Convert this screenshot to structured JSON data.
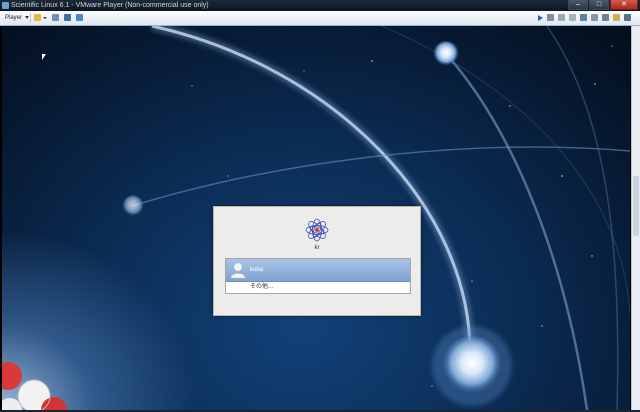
{
  "window": {
    "title": "Scientific Linux 6.1 - VMware Player (Non-commercial use only)",
    "buttons": {
      "minimize": "–",
      "maximize": "□",
      "close": "✕"
    }
  },
  "toolbar": {
    "player_menu": "Player",
    "left_icons": [
      "folder-icon",
      "vm-settings-icon",
      "fullscreen-icon",
      "unity-icon"
    ],
    "right_icons": [
      "play-icon",
      "network-adapter-icon",
      "usb-icon",
      "hard-disk-icon",
      "cd-drive-icon",
      "printer-icon",
      "sound-icon",
      "message-icon",
      "display-icon"
    ]
  },
  "login": {
    "hostname": "kr",
    "users": [
      {
        "name": "koba",
        "selected": true
      }
    ],
    "other": "その他..."
  },
  "colors": {
    "selection": "#8fb0dc",
    "desktop_deep": "#06162c",
    "desktop_glow": "#aac8eb"
  }
}
